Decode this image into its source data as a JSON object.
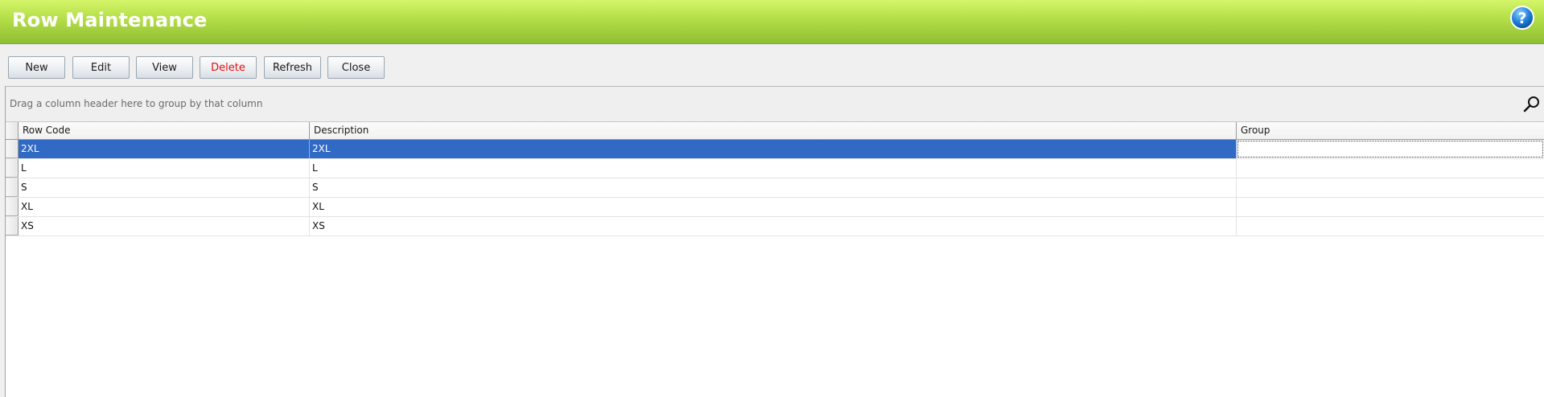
{
  "window": {
    "title": "Row Maintenance"
  },
  "toolbar": {
    "new_label": "New",
    "edit_label": "Edit",
    "view_label": "View",
    "delete_label": "Delete",
    "refresh_label": "Refresh",
    "close_label": "Close"
  },
  "grid": {
    "group_hint": "Drag a column header here to group by that column",
    "columns": [
      "Row Code",
      "Description",
      "Group"
    ],
    "rows": [
      {
        "code": "2XL",
        "description": "2XL",
        "group": ""
      },
      {
        "code": "L",
        "description": "L",
        "group": ""
      },
      {
        "code": "S",
        "description": "S",
        "group": ""
      },
      {
        "code": "XL",
        "description": "XL",
        "group": ""
      },
      {
        "code": "XS",
        "description": "XS",
        "group": ""
      }
    ],
    "selected_row": 0
  },
  "colors": {
    "title_bar_green": "#b6e04a",
    "selection_blue": "#316ac5",
    "delete_red": "#e01010"
  },
  "icons": {
    "help": "help-icon",
    "search": "search-icon",
    "current_row": "row-indicator-arrow-icon"
  }
}
